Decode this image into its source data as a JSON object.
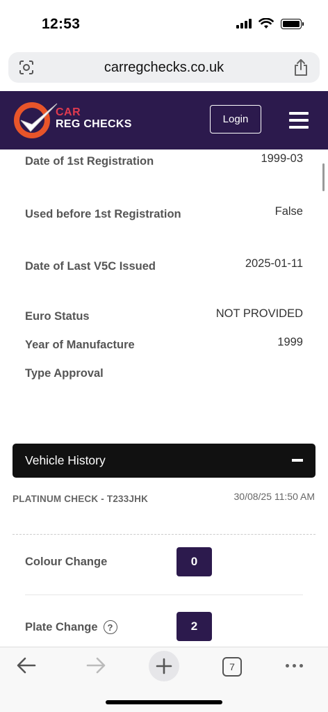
{
  "status_bar": {
    "time": "12:53"
  },
  "browser": {
    "url": "carregchecks.co.uk",
    "tab_count": "7"
  },
  "site": {
    "logo_line1": "CAR",
    "logo_line2": "REG CHECKS",
    "login_label": "Login",
    "brand_color": "#2c1a4d",
    "accent_color": "#e03a4f"
  },
  "details": [
    {
      "label": "Date of 1st Registration",
      "value": "1999-03"
    },
    {
      "label": "Used before 1st Registration",
      "value": "False"
    },
    {
      "label": "Date of Last V5C Issued",
      "value": "2025-01-11"
    },
    {
      "label": "Euro Status",
      "value": "NOT PROVIDED"
    },
    {
      "label": "Year of Manufacture",
      "value": "1999"
    },
    {
      "label": "Type Approval",
      "value": ""
    }
  ],
  "vehicle_history": {
    "title": "Vehicle History",
    "toggle_symbol": "minus",
    "check_name": "PLATINUM CHECK - T233JHK",
    "check_date": "30/08/25 11:50 AM",
    "rows": [
      {
        "label": "Colour Change",
        "count": "0",
        "has_help": false
      },
      {
        "label": "Plate Change",
        "count": "2",
        "has_help": true,
        "help_symbol": "?"
      }
    ]
  },
  "toolbar": {
    "icons": [
      "back-arrow-icon",
      "forward-arrow-icon",
      "new-tab-plus-icon",
      "tabs-icon",
      "more-icon"
    ]
  }
}
